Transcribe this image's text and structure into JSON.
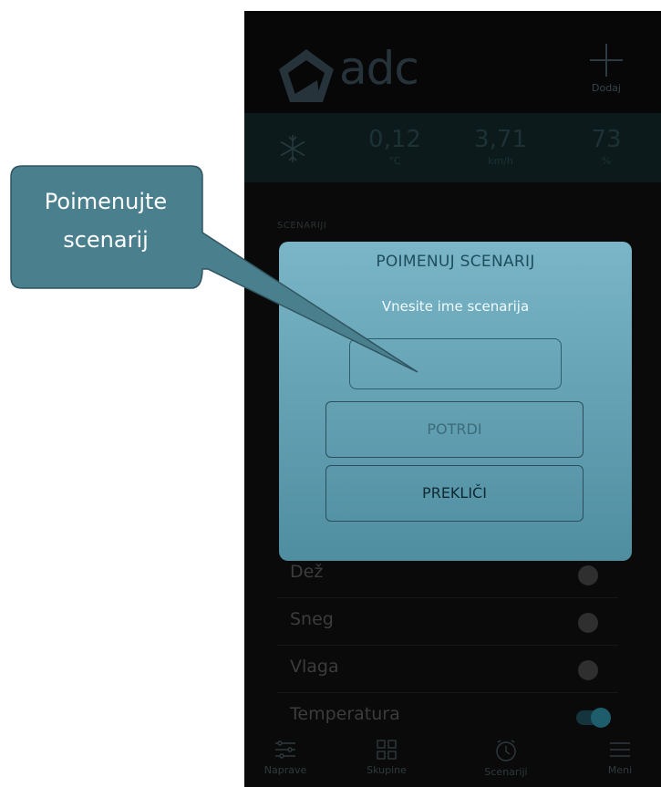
{
  "app": {
    "logo_text": "adc",
    "add_label": "Dodaj"
  },
  "weather": {
    "icon": "snowflake-icon",
    "temperature_value": "0,12",
    "temperature_unit": "°C",
    "wind_value": "3,71",
    "wind_unit": "km/h",
    "humidity_value": "73",
    "humidity_unit": "%"
  },
  "section_label": "SCENARIJI",
  "conditions": [
    {
      "label": "Dež",
      "enabled": false
    },
    {
      "label": "Sneg",
      "enabled": false
    },
    {
      "label": "Vlaga",
      "enabled": false
    },
    {
      "label": "Temperatura",
      "enabled": true
    }
  ],
  "tabs": [
    {
      "label": "Naprave",
      "icon": "sliders-icon"
    },
    {
      "label": "Skupine",
      "icon": "grid-icon"
    },
    {
      "label": "Scenariji",
      "icon": "clock-icon"
    },
    {
      "label": "Meni",
      "icon": "menu-icon"
    }
  ],
  "dialog": {
    "title": "POIMENUJ SCENARIJ",
    "subtitle": "Vnesite ime scenarija",
    "input_value": "",
    "confirm_label": "POTRDI",
    "cancel_label": "PREKLIČI"
  },
  "callout": {
    "line1": "Poimenujte",
    "line2": "scenarij"
  },
  "colors": {
    "dialog_top": "#7ab6c8",
    "dialog_bottom": "#4f8da0",
    "callout_fill": "#4a7f8e",
    "accent": "#1d5d6c"
  }
}
